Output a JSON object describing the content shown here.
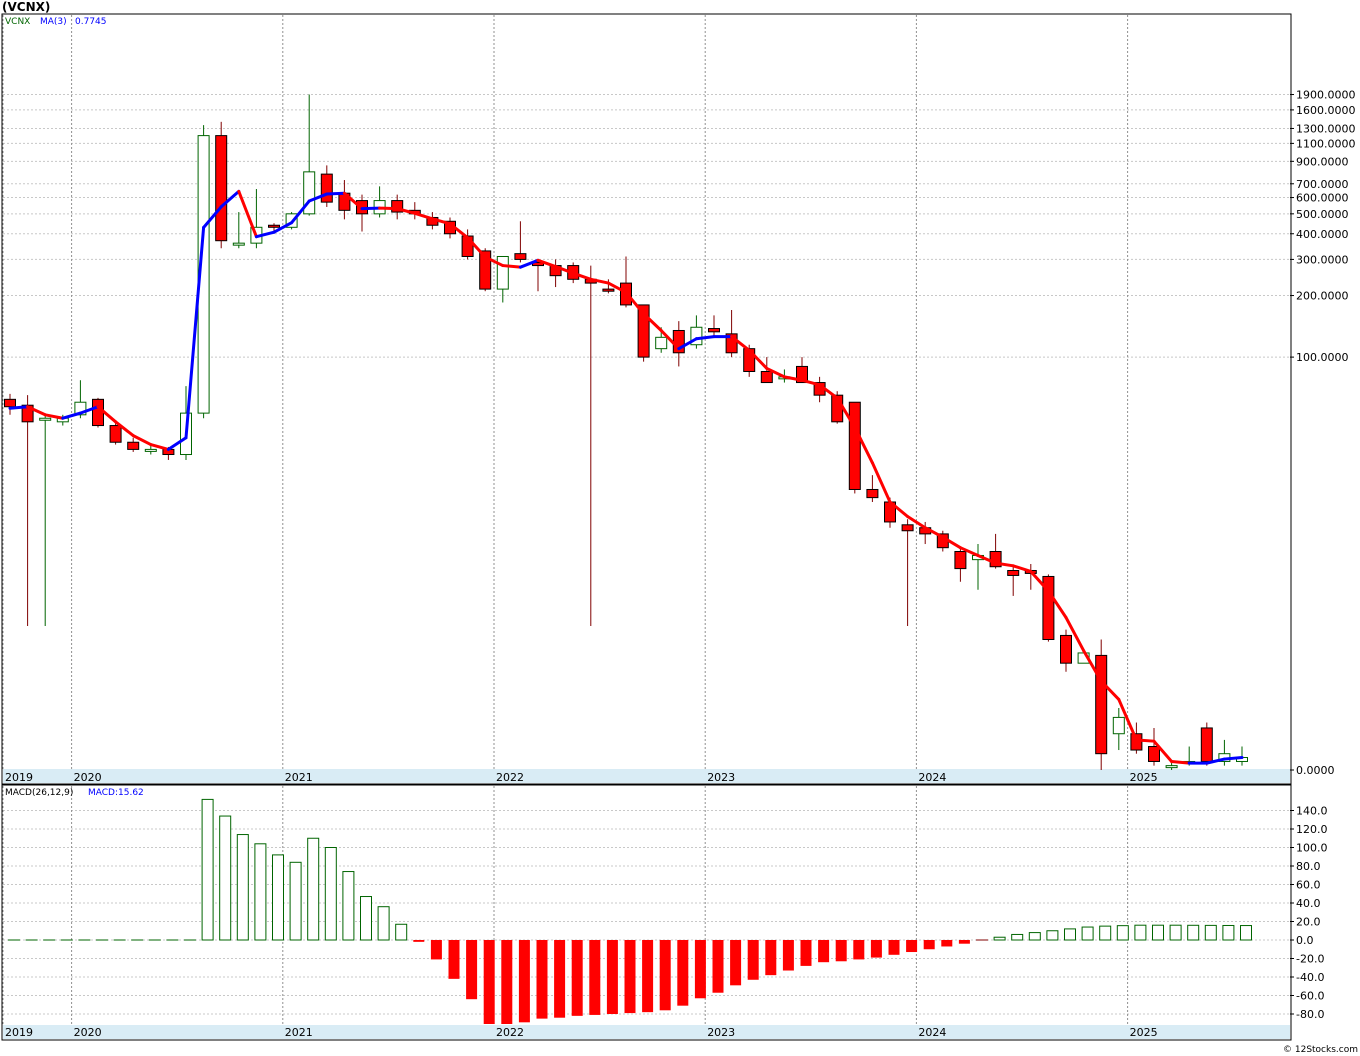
{
  "title": "(VCNX)",
  "watermark": "© 12Stocks.com",
  "colors": {
    "up_candle": "#006400",
    "down_candle": "#ff0000",
    "ma_up": "#0000ff",
    "ma_down": "#ff0000",
    "grid": "#c8c8c8",
    "year_grid": "#909090",
    "axis_band": "#d9ecf5",
    "macd_pos": "#006400",
    "macd_neg": "#ff0000"
  },
  "price_panel": {
    "legend_symbol": "VCNX",
    "legend_ma": "MA(3)",
    "legend_value": "0.7745"
  },
  "macd_panel": {
    "legend_name": "MACD(26,12,9)",
    "legend_value": "MACD:15.62"
  },
  "chart_data": [
    {
      "type": "candlestick",
      "title": "(VCNX)",
      "x_unit": "month",
      "y_scale": "log",
      "series_ma": "MA(3)",
      "start_month": "2019-09",
      "year_labels": [
        "2019",
        "2020",
        "2021",
        "2022",
        "2023",
        "2024",
        "2025"
      ],
      "y_ticks": [
        "1900.0000",
        "1600.0000",
        "1300.0000",
        "1100.0000",
        "900.0000",
        "700.0000",
        "600.0000",
        "500.0000",
        "400.0000",
        "300.0000",
        "200.0000",
        "100.0000",
        "0.0000"
      ],
      "ohlc": [
        [
          62,
          66,
          52,
          57
        ],
        [
          58,
          65,
          4,
          48
        ],
        [
          50,
          52,
          4,
          50
        ],
        [
          48,
          52,
          46,
          50
        ],
        [
          52,
          77,
          50,
          60
        ],
        [
          62,
          63,
          45,
          46
        ],
        [
          46,
          49,
          37,
          38
        ],
        [
          38,
          40,
          34,
          35
        ],
        [
          35,
          37,
          33,
          35
        ],
        [
          35,
          36,
          31,
          33
        ],
        [
          33,
          72,
          31,
          53
        ],
        [
          53,
          1350,
          50,
          1200
        ],
        [
          1200,
          1400,
          340,
          370
        ],
        [
          360,
          510,
          340,
          360
        ],
        [
          360,
          660,
          340,
          430
        ],
        [
          440,
          450,
          400,
          430
        ],
        [
          430,
          510,
          420,
          500
        ],
        [
          500,
          1900,
          490,
          800
        ],
        [
          780,
          860,
          540,
          570
        ],
        [
          630,
          730,
          470,
          520
        ],
        [
          580,
          620,
          410,
          500
        ],
        [
          500,
          680,
          480,
          580
        ],
        [
          580,
          620,
          470,
          510
        ],
        [
          520,
          570,
          470,
          500
        ],
        [
          480,
          510,
          420,
          440
        ],
        [
          460,
          480,
          380,
          400
        ],
        [
          390,
          420,
          300,
          310
        ],
        [
          330,
          340,
          210,
          215
        ],
        [
          215,
          310,
          185,
          310
        ],
        [
          320,
          460,
          290,
          300
        ],
        [
          290,
          300,
          210,
          280
        ],
        [
          280,
          300,
          220,
          250
        ],
        [
          280,
          290,
          230,
          240
        ],
        [
          240,
          280,
          4,
          230
        ],
        [
          215,
          240,
          205,
          210
        ],
        [
          230,
          310,
          175,
          180
        ],
        [
          180,
          180,
          95,
          100
        ],
        [
          110,
          140,
          105,
          125
        ],
        [
          135,
          150,
          90,
          105
        ],
        [
          115,
          160,
          110,
          140
        ],
        [
          138,
          160,
          125,
          133
        ],
        [
          130,
          170,
          100,
          105
        ],
        [
          110,
          115,
          80,
          85
        ],
        [
          85,
          100,
          75,
          75
        ],
        [
          80,
          87,
          75,
          80
        ],
        [
          90,
          100,
          75,
          75
        ],
        [
          75,
          80,
          60,
          65
        ],
        [
          65,
          68,
          47,
          48
        ],
        [
          60,
          60,
          21,
          22
        ],
        [
          22,
          26,
          19,
          20
        ],
        [
          19,
          20,
          14,
          15
        ],
        [
          14.5,
          15.5,
          4,
          13.5
        ],
        [
          14,
          15,
          11.5,
          13
        ],
        [
          13,
          13.5,
          10.5,
          11
        ],
        [
          10.5,
          11,
          7.2,
          8.5
        ],
        [
          9.5,
          11.5,
          6.5,
          10
        ],
        [
          10.5,
          13,
          8.5,
          8.7
        ],
        [
          8.3,
          8.7,
          6,
          7.8
        ],
        [
          8.3,
          9,
          6.5,
          8
        ],
        [
          7.7,
          7.9,
          3.2,
          3.3
        ],
        [
          3.5,
          3.8,
          2.0,
          2.3
        ],
        [
          2.3,
          2.7,
          2.3,
          2.7
        ],
        [
          2.6,
          3.3,
          0,
          0.2
        ],
        [
          0.5,
          1.0,
          0.25,
          0.8
        ],
        [
          0.5,
          0.7,
          0.2,
          0.25
        ],
        [
          0.3,
          0.6,
          0.05,
          0.1
        ],
        [
          0.05,
          0.1,
          0,
          0.05
        ],
        [
          0.08,
          0.3,
          0.05,
          0.1
        ],
        [
          0.6,
          0.7,
          0.05,
          0.1
        ],
        [
          0.1,
          0.4,
          0.05,
          0.2
        ],
        [
          0.1,
          0.3,
          0.05,
          0.15
        ]
      ],
      "ma": [
        56,
        57,
        52,
        50,
        53,
        57,
        48,
        41,
        37,
        35,
        40,
        429,
        541,
        643,
        387,
        407,
        453,
        577,
        624,
        630,
        530,
        533,
        530,
        503,
        473,
        447,
        383,
        308,
        280,
        275,
        297,
        277,
        257,
        240,
        230,
        207,
        163,
        135,
        110,
        123,
        126,
        126,
        108,
        88,
        80,
        77,
        73,
        63,
        45,
        30,
        19,
        16,
        14,
        12.5,
        11,
        10,
        9.1,
        8.8,
        8.2,
        6.4,
        4.5,
        2.8,
        1.7,
        1.2,
        0.4,
        0.38,
        0.1,
        0.08,
        0.08,
        0.13,
        0.15
      ]
    },
    {
      "type": "bar",
      "title": "MACD(26,12,9)",
      "y_ticks": [
        "140.0",
        "120.0",
        "100.0",
        "80.0",
        "60.0",
        "40.0",
        "20.0",
        "0.0",
        "-20.0",
        "-40.0",
        "-60.0",
        "-80.0"
      ],
      "ylim": [
        -92,
        153
      ],
      "values": [
        0,
        0,
        0,
        0,
        0,
        0,
        0,
        0,
        0,
        0,
        0,
        152,
        134,
        114,
        104,
        92,
        84,
        110,
        100,
        74,
        47,
        36,
        17,
        -2,
        -21,
        -42,
        -64,
        -91,
        -92,
        -89,
        -85,
        -84,
        -82,
        -81,
        -80,
        -79,
        -78,
        -76,
        -71,
        -63,
        -57,
        -49,
        -43,
        -38,
        -33,
        -28,
        -24,
        -23,
        -21,
        -19,
        -16,
        -13,
        -10,
        -7,
        -4,
        0,
        3,
        6,
        8,
        10,
        12,
        14,
        15,
        15.5,
        16,
        16,
        16,
        15.9,
        15.8,
        15.7,
        15.62
      ]
    }
  ]
}
